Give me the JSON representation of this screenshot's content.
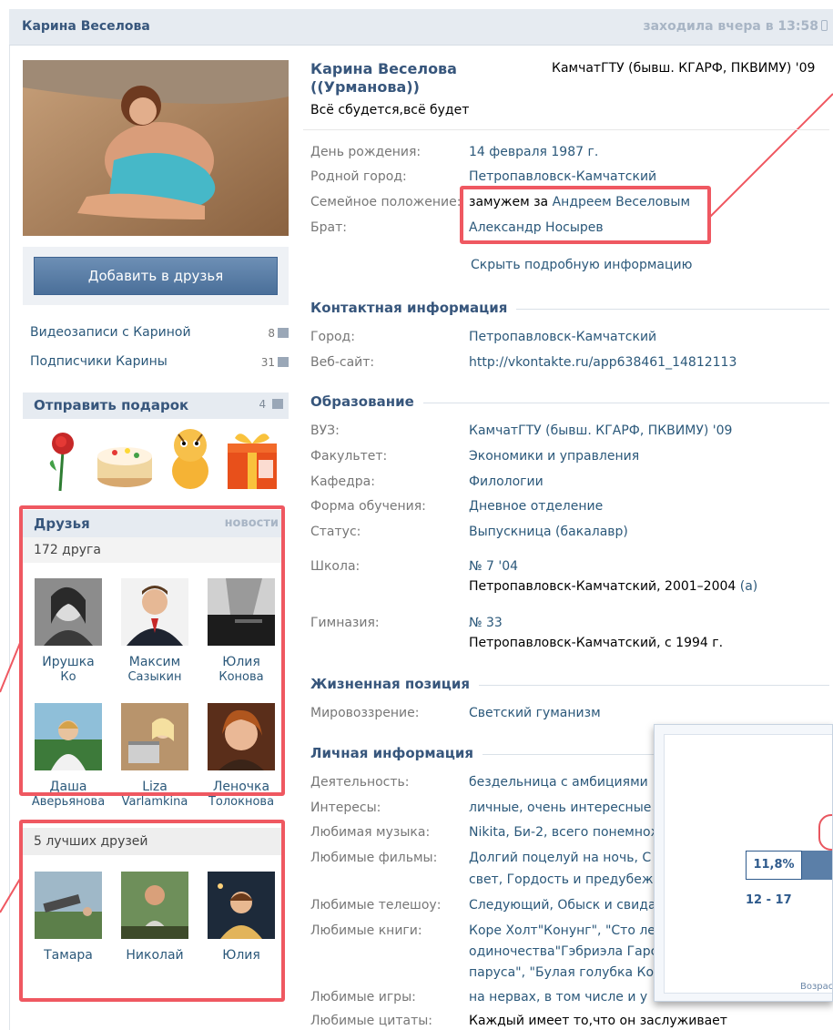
{
  "header": {
    "name": "Карина Веселова",
    "last_seen": "заходила вчера в 13:58"
  },
  "left": {
    "add_friend": "Добавить в друзья",
    "links": [
      {
        "label": "Видеозаписи с Кариной",
        "count": "8"
      },
      {
        "label": "Подписчики Карины",
        "count": "31"
      }
    ],
    "gift_title": "Отправить подарок",
    "gift_count": "4",
    "friends_title": "Друзья",
    "friends_news": "новости",
    "friends_count": "172 друга",
    "friends": [
      {
        "first": "Ирушка",
        "last": "Ко"
      },
      {
        "first": "Максим",
        "last": "Сазыкин"
      },
      {
        "first": "Юлия",
        "last": "Конова"
      },
      {
        "first": "Даша",
        "last": "Аверьянова"
      },
      {
        "first": "Liza",
        "last": "Varlamkina"
      },
      {
        "first": "Леночка",
        "last": "Толокнова"
      }
    ],
    "best_title": "5 лучших друзей",
    "best": [
      "Тамара",
      "Николай",
      "Юлия"
    ]
  },
  "profile": {
    "name_line1": "Карина Веселова",
    "name_line2": "((Урманова))",
    "uni_short": "КамчатГТУ (бывш. КГАРФ, ПКВИМУ) '09",
    "status": "Всё сбудется,всё будет",
    "birthday_label": "День рождения:",
    "birthday": "14 февраля 1987 г.",
    "hometown_label": "Родной город:",
    "hometown": "Петропавловск-Камчатский",
    "family_label": "Семейное положение:",
    "family_prefix": "замужем за",
    "family_link": "Андреем Веселовым",
    "brother_label": "Брат:",
    "brother": "Александр Носырев",
    "hide_info": "Скрыть подробную информацию"
  },
  "contact": {
    "title": "Контактная информация",
    "city_label": "Город:",
    "city": "Петропавловск-Камчатский",
    "site_label": "Веб-сайт:",
    "site": "http://vkontakte.ru/app638461_14812113"
  },
  "education": {
    "title": "Образование",
    "uni_label": "ВУЗ:",
    "uni": "КамчатГТУ (бывш. КГАРФ, ПКВИМУ) '09",
    "faculty_label": "Факультет:",
    "faculty": "Экономики и управления",
    "chair_label": "Кафедра:",
    "chair": "Филологии",
    "form_label": "Форма обучения:",
    "form": "Дневное отделение",
    "status_label": "Статус:",
    "status": "Выпускница (бакалавр)",
    "school_label": "Школа:",
    "school": "№ 7 '04",
    "school_detail": "Петропавловск-Камчатский, 2001–2004",
    "school_suffix": "(а)",
    "gym_label": "Гимназия:",
    "gym": "№ 33",
    "gym_detail": "Петропавловск-Камчатский, с 1994 г."
  },
  "position": {
    "title": "Жизненная позиция",
    "worldview_label": "Мировоззрение:",
    "worldview": "Светский гуманизм"
  },
  "personal": {
    "title": "Личная информация",
    "rows": [
      {
        "label": "Деятельность:",
        "value": "бездельница с амбициями"
      },
      {
        "label": "Интересы:",
        "value": "личные, очень интересные"
      },
      {
        "label": "Любимая музыка:",
        "value": "Nikita, Би-2, всего понемнож"
      },
      {
        "label": "Любимые фильмы:",
        "value": "Долгий поцелуй на ночь, С",
        "value2": "свет, Гордость и предубеж"
      },
      {
        "label": "Любимые телешоу:",
        "value": "Следующий, Обыск и свида"
      },
      {
        "label": "Любимые книги:",
        "value": "Коре Холт\"Конунг\", \"Сто ле",
        "value2": "одиночества\"Гэбриэла Гарс",
        "value3": "паруса\", \"Булая голубка Ко"
      },
      {
        "label": "Любимые игры:",
        "value": "на нервах, в том числе и у"
      },
      {
        "label": "Любимые цитаты:",
        "value": "Каждый имеет то,что он заслуживает"
      }
    ]
  },
  "overlay": {
    "value_label": "11,8%",
    "x_label": "12 - 17",
    "footer": "Возраст"
  },
  "colors": {
    "link": "#2b587a",
    "header_bg": "#e6ebf1",
    "highlight": "#ef5861"
  }
}
